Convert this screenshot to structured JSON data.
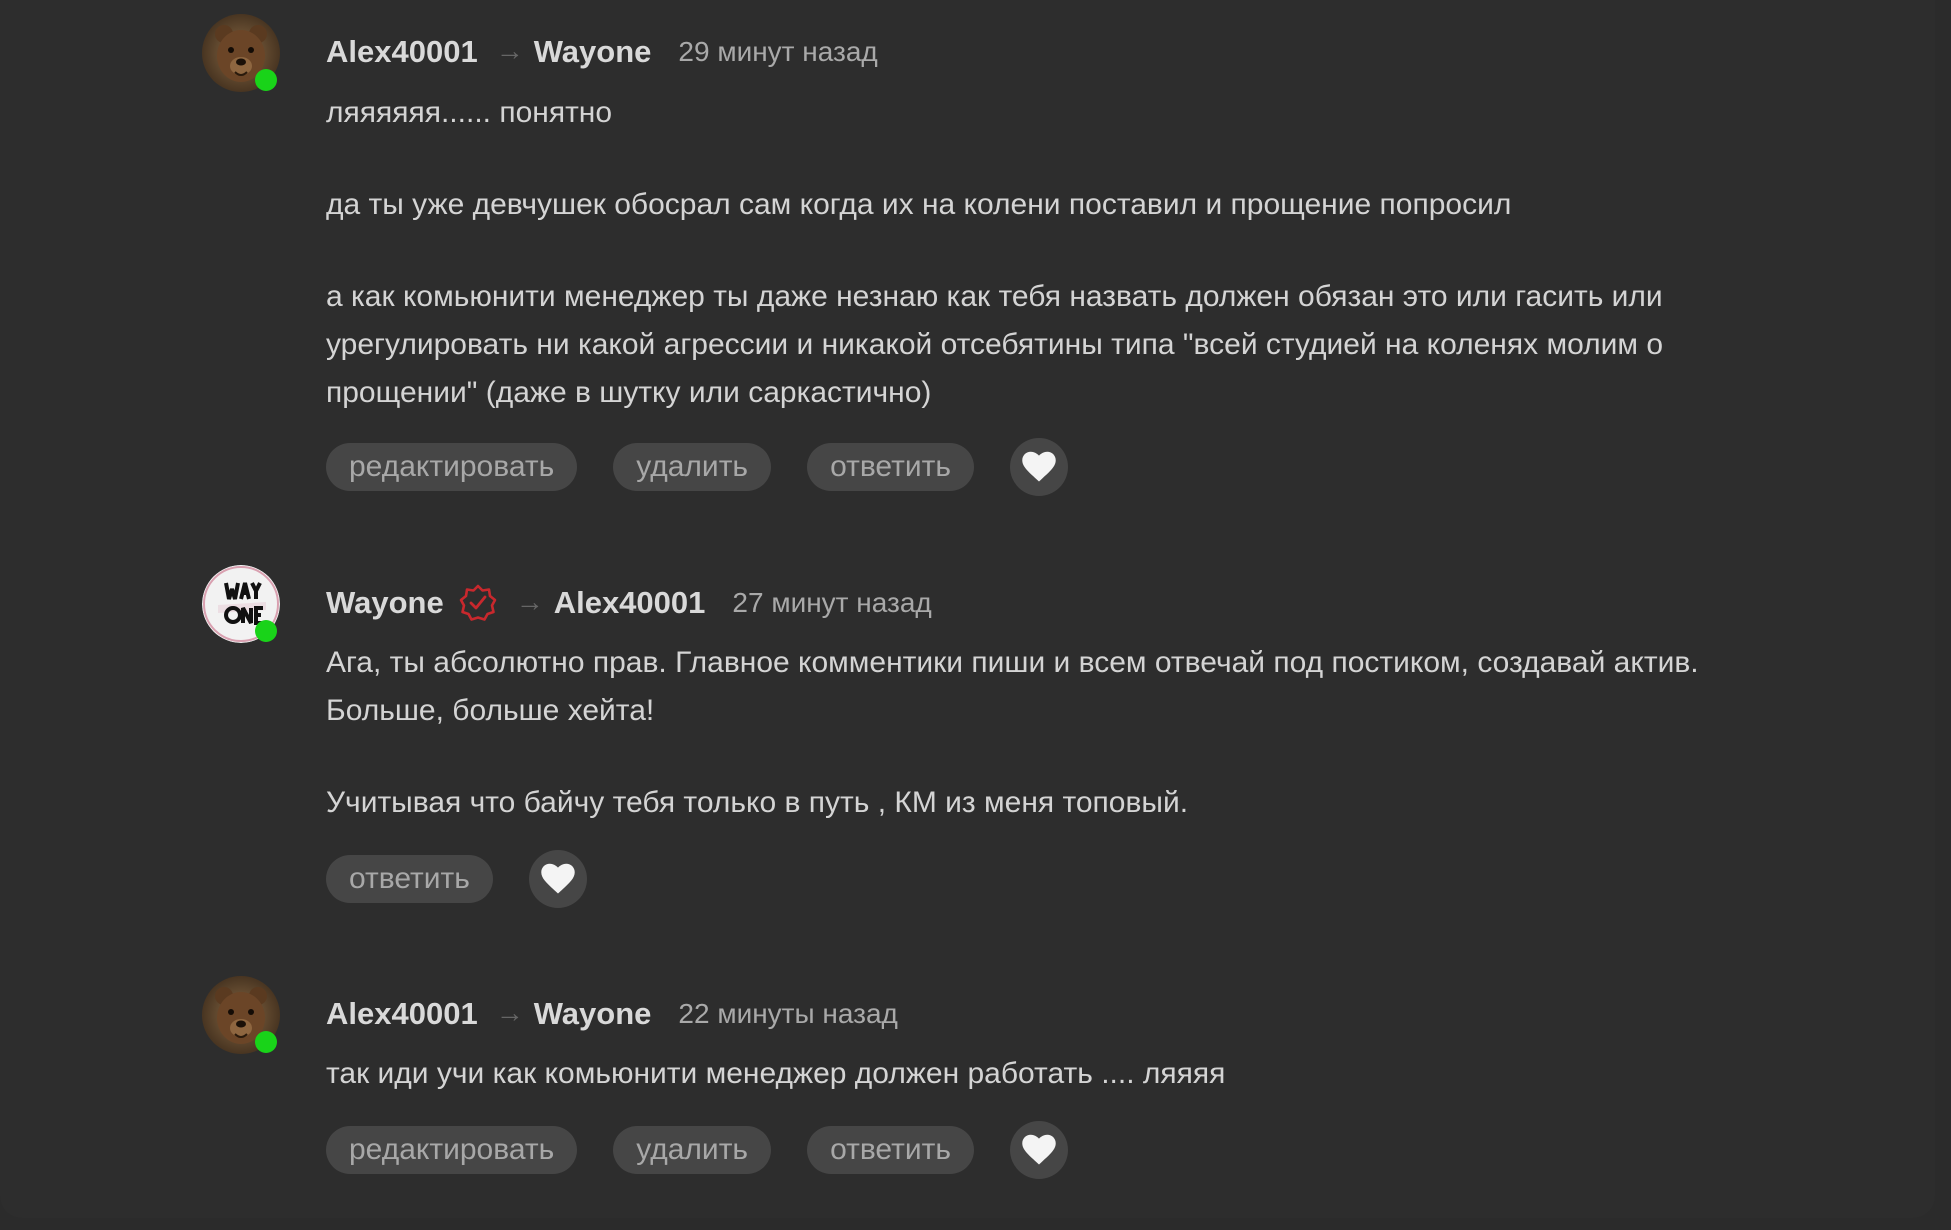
{
  "comments": [
    {
      "author": "Alex40001",
      "recipient": "Wayone",
      "time": "29 минут назад",
      "avatar": "bear-avatar",
      "online": true,
      "verified": false,
      "paragraphs": [
        "ляяяяяя...... понятно",
        "да ты уже девчушек обосрал сам когда их на колени поставил и прощение попросил",
        "а как комьюнити менеджер ты даже незнаю как тебя назвать должен обязан это или гасить или урегулировать ни какой агрессии и никакой отсебятины типа \"всей студией на коленях молим о прощении\" (даже в шутку или саркастично)"
      ],
      "actions": [
        "редактировать",
        "удалить",
        "ответить"
      ]
    },
    {
      "author": "Wayone",
      "recipient": "Alex40001",
      "time": "27 минут назад",
      "avatar": "wayone-logo-avatar",
      "online": true,
      "verified": true,
      "paragraphs": [
        "Ага, ты абсолютно прав. Главное комментики пиши и всем отвечай под постиком, создавай актив. Больше, больше хейта!",
        "Учитывая что байчу тебя только в путь , КМ из меня топовый."
      ],
      "actions": [
        "ответить"
      ]
    },
    {
      "author": "Alex40001",
      "recipient": "Wayone",
      "time": "22 минуты назад",
      "avatar": "bear-avatar",
      "online": true,
      "verified": false,
      "paragraphs": [
        "так иди учи как комьюнити менеджер должен работать .... ляяяя"
      ],
      "actions": [
        "редактировать",
        "удалить",
        "ответить"
      ]
    }
  ],
  "icons": {
    "arrow": "→",
    "like": "heart-icon",
    "verified": "verified-badge-icon",
    "online": "online-status-dot"
  },
  "colors": {
    "background": "#2d2d2d",
    "button": "#464646",
    "online": "#19d319",
    "verified": "#c8282d"
  }
}
